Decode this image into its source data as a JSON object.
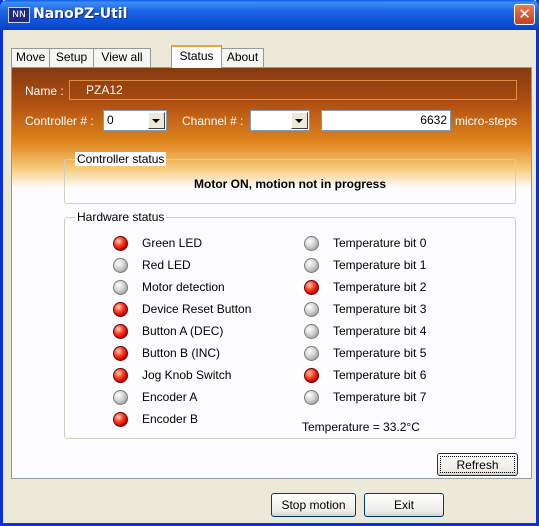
{
  "window": {
    "title": "NanoPZ-Util",
    "icon_text": "NN",
    "close_symbol": "✕"
  },
  "tabs": [
    {
      "label": "Move",
      "active": false
    },
    {
      "label": "Setup",
      "active": false
    },
    {
      "label": "View all",
      "active": false
    },
    {
      "label": "Status",
      "active": true
    },
    {
      "label": "About",
      "active": false
    }
  ],
  "header": {
    "name_label": "Name :",
    "name_value": "PZA12",
    "controller_label": "Controller # :",
    "controller_value": "0",
    "channel_label": "Channel # :",
    "channel_value": "",
    "position_value": "6632",
    "position_unit": "micro-steps"
  },
  "controller_status": {
    "title": "Controller status",
    "message": "Motor ON, motion not in progress"
  },
  "hardware_status": {
    "title": "Hardware status",
    "left": [
      {
        "label": "Green LED",
        "state": "on"
      },
      {
        "label": "Red LED",
        "state": "off"
      },
      {
        "label": "Motor detection",
        "state": "off"
      },
      {
        "label": "Device Reset Button",
        "state": "on"
      },
      {
        "label": "Button A (DEC)",
        "state": "on"
      },
      {
        "label": "Button B (INC)",
        "state": "on"
      },
      {
        "label": "Jog Knob Switch",
        "state": "on"
      },
      {
        "label": "Encoder A",
        "state": "off"
      },
      {
        "label": "Encoder B",
        "state": "on"
      }
    ],
    "right": [
      {
        "label": "Temperature bit 0",
        "state": "off"
      },
      {
        "label": "Temperature bit 1",
        "state": "off"
      },
      {
        "label": "Temperature bit 2",
        "state": "on"
      },
      {
        "label": "Temperature bit 3",
        "state": "off"
      },
      {
        "label": "Temperature bit 4",
        "state": "off"
      },
      {
        "label": "Temperature bit 5",
        "state": "off"
      },
      {
        "label": "Temperature bit 6",
        "state": "on"
      },
      {
        "label": "Temperature bit 7",
        "state": "off"
      }
    ],
    "temperature_text": "Temperature = 33.2°C"
  },
  "buttons": {
    "refresh": "Refresh",
    "stop_motion": "Stop motion",
    "exit": "Exit"
  },
  "colors": {
    "title_bar": "#0b4fd6",
    "led_on": "#cc0000",
    "led_off": "#a8a8a8",
    "banner": "#b25012"
  }
}
